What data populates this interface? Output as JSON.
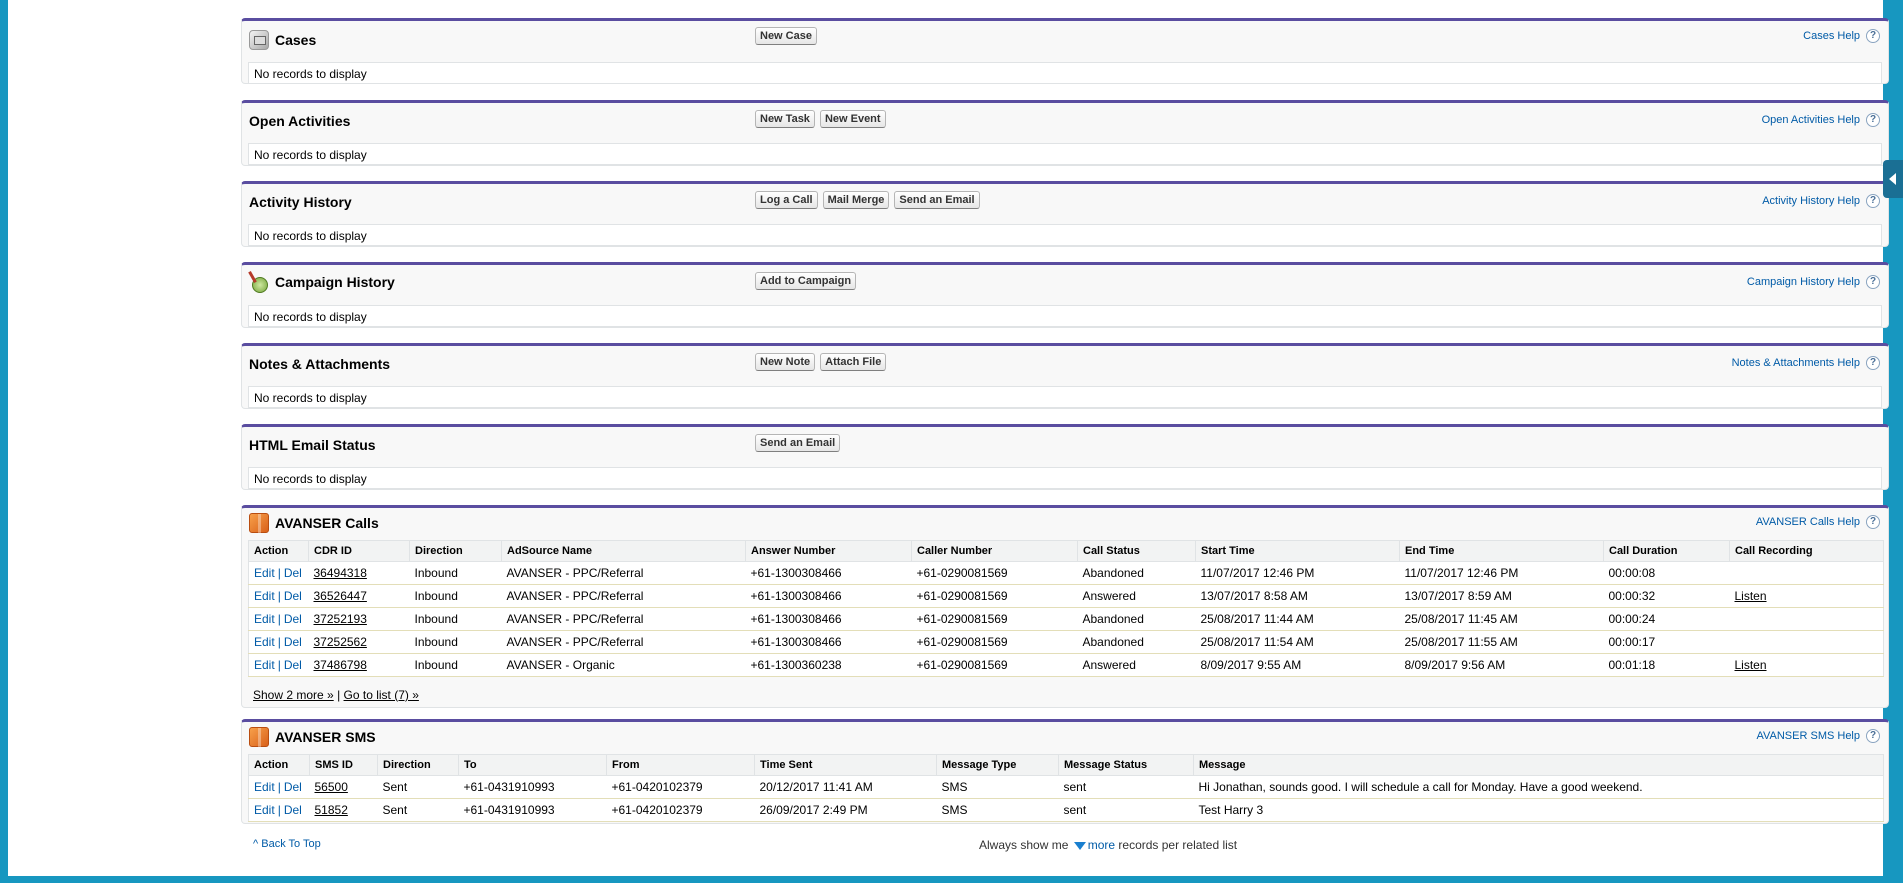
{
  "sections": {
    "cases": {
      "title": "Cases",
      "buttons": [
        "New Case"
      ],
      "help": "Cases Help",
      "empty": "No records to display"
    },
    "open_activities": {
      "title": "Open Activities",
      "buttons": [
        "New Task",
        "New Event"
      ],
      "help": "Open Activities Help",
      "empty": "No records to display"
    },
    "activity_history": {
      "title": "Activity History",
      "buttons": [
        "Log a Call",
        "Mail Merge",
        "Send an Email"
      ],
      "help": "Activity History Help",
      "empty": "No records to display"
    },
    "campaign_history": {
      "title": "Campaign History",
      "buttons": [
        "Add to Campaign"
      ],
      "help": "Campaign History Help",
      "empty": "No records to display"
    },
    "notes_attachments": {
      "title": "Notes & Attachments",
      "buttons": [
        "New Note",
        "Attach File"
      ],
      "help": "Notes & Attachments Help",
      "empty": "No records to display"
    },
    "html_email_status": {
      "title": "HTML Email Status",
      "buttons": [
        "Send an Email"
      ],
      "empty": "No records to display"
    }
  },
  "help_glyph": "?",
  "avanser_calls": {
    "title": "AVANSER Calls",
    "help": "AVANSER Calls Help",
    "columns": [
      "Action",
      "CDR ID",
      "Direction",
      "AdSource Name",
      "Answer Number",
      "Caller Number",
      "Call Status",
      "Start Time",
      "End Time",
      "Call Duration",
      "Call Recording"
    ],
    "rows": [
      {
        "edit": "Edit",
        "del": "Del",
        "id": "36494318",
        "direction": "Inbound",
        "adsource": "AVANSER - PPC/Referral",
        "answer": "+61-1300308466",
        "caller": "+61-0290081569",
        "status": "Abandoned",
        "start": "11/07/2017 12:46 PM",
        "end": "11/07/2017 12:46 PM",
        "duration": "00:00:08",
        "recording": ""
      },
      {
        "edit": "Edit",
        "del": "Del",
        "id": "36526447",
        "direction": "Inbound",
        "adsource": "AVANSER - PPC/Referral",
        "answer": "+61-1300308466",
        "caller": "+61-0290081569",
        "status": "Answered",
        "start": "13/07/2017 8:58 AM",
        "end": "13/07/2017 8:59 AM",
        "duration": "00:00:32",
        "recording": "Listen"
      },
      {
        "edit": "Edit",
        "del": "Del",
        "id": "37252193",
        "direction": "Inbound",
        "adsource": "AVANSER - PPC/Referral",
        "answer": "+61-1300308466",
        "caller": "+61-0290081569",
        "status": "Abandoned",
        "start": "25/08/2017 11:44 AM",
        "end": "25/08/2017 11:45 AM",
        "duration": "00:00:24",
        "recording": ""
      },
      {
        "edit": "Edit",
        "del": "Del",
        "id": "37252562",
        "direction": "Inbound",
        "adsource": "AVANSER - PPC/Referral",
        "answer": "+61-1300308466",
        "caller": "+61-0290081569",
        "status": "Abandoned",
        "start": "25/08/2017 11:54 AM",
        "end": "25/08/2017 11:55 AM",
        "duration": "00:00:17",
        "recording": ""
      },
      {
        "edit": "Edit",
        "del": "Del",
        "id": "37486798",
        "direction": "Inbound",
        "adsource": "AVANSER - Organic",
        "answer": "+61-1300360238",
        "caller": "+61-0290081569",
        "status": "Answered",
        "start": "8/09/2017 9:55 AM",
        "end": "8/09/2017 9:56 AM",
        "duration": "00:01:18",
        "recording": "Listen"
      }
    ],
    "show_more": "Show 2 more »",
    "separator": "|",
    "go_to_list": "Go to list (7) »"
  },
  "avanser_sms": {
    "title": "AVANSER SMS",
    "help": "AVANSER SMS Help",
    "columns": [
      "Action",
      "SMS ID",
      "Direction",
      "To",
      "From",
      "Time Sent",
      "Message Type",
      "Message Status",
      "Message"
    ],
    "rows": [
      {
        "edit": "Edit",
        "del": "Del",
        "id": "56500",
        "direction": "Sent",
        "to": "+61-0431910993",
        "from": "+61-0420102379",
        "time": "20/12/2017 11:41 AM",
        "type": "SMS",
        "status": "sent",
        "message": "Hi Jonathan, sounds good. I will schedule a call for Monday. Have a good weekend."
      },
      {
        "edit": "Edit",
        "del": "Del",
        "id": "51852",
        "direction": "Sent",
        "to": "+61-0431910993",
        "from": "+61-0420102379",
        "time": "26/09/2017 2:49 PM",
        "type": "SMS",
        "status": "sent",
        "message": "Test Harry 3"
      }
    ]
  },
  "footer": {
    "back_to_top": "Back To Top",
    "always_show": "Always show me",
    "more": "more",
    "per_list": "records per related list"
  }
}
